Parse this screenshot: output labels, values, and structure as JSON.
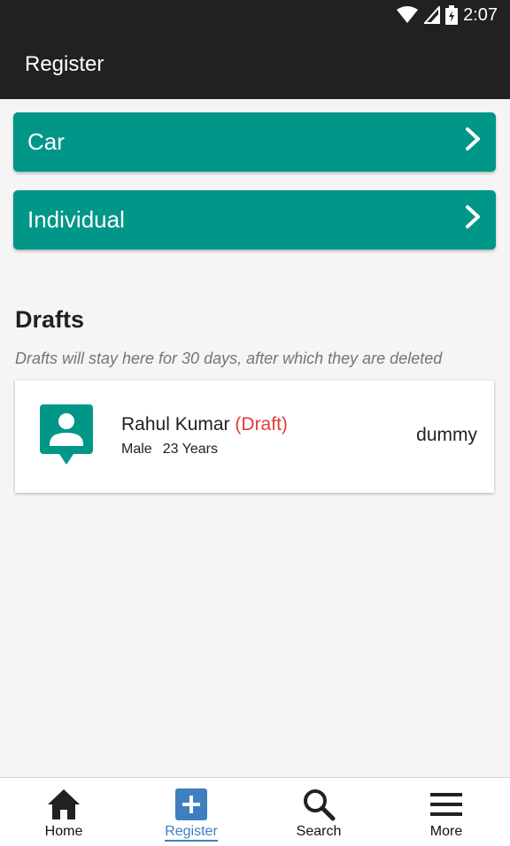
{
  "status_bar": {
    "time": "2:07",
    "icons": [
      "wifi-icon",
      "signal-icon",
      "battery-charging-icon"
    ]
  },
  "app_bar": {
    "title": "Register"
  },
  "register_options": [
    {
      "label": "Car",
      "icon": "chevron-right-icon"
    },
    {
      "label": "Individual",
      "icon": "chevron-right-icon"
    }
  ],
  "drafts": {
    "title": "Drafts",
    "note": "Drafts will stay here for 30 days, after which they are deleted",
    "items": [
      {
        "name": "Rahul Kumar",
        "status": "(Draft)",
        "gender": "Male",
        "age": "23 Years",
        "right_text": "dummy",
        "icon": "person-badge-icon"
      }
    ]
  },
  "bottom_nav": [
    {
      "label": "Home",
      "icon": "home-icon",
      "active": false
    },
    {
      "label": "Register",
      "icon": "plus-box-icon",
      "active": true
    },
    {
      "label": "Search",
      "icon": "search-icon",
      "active": false
    },
    {
      "label": "More",
      "icon": "menu-icon",
      "active": false
    }
  ],
  "colors": {
    "accent": "#009688",
    "draft_tag": "#e53935",
    "nav_active": "#3f7fbf",
    "app_bar": "#212121"
  }
}
